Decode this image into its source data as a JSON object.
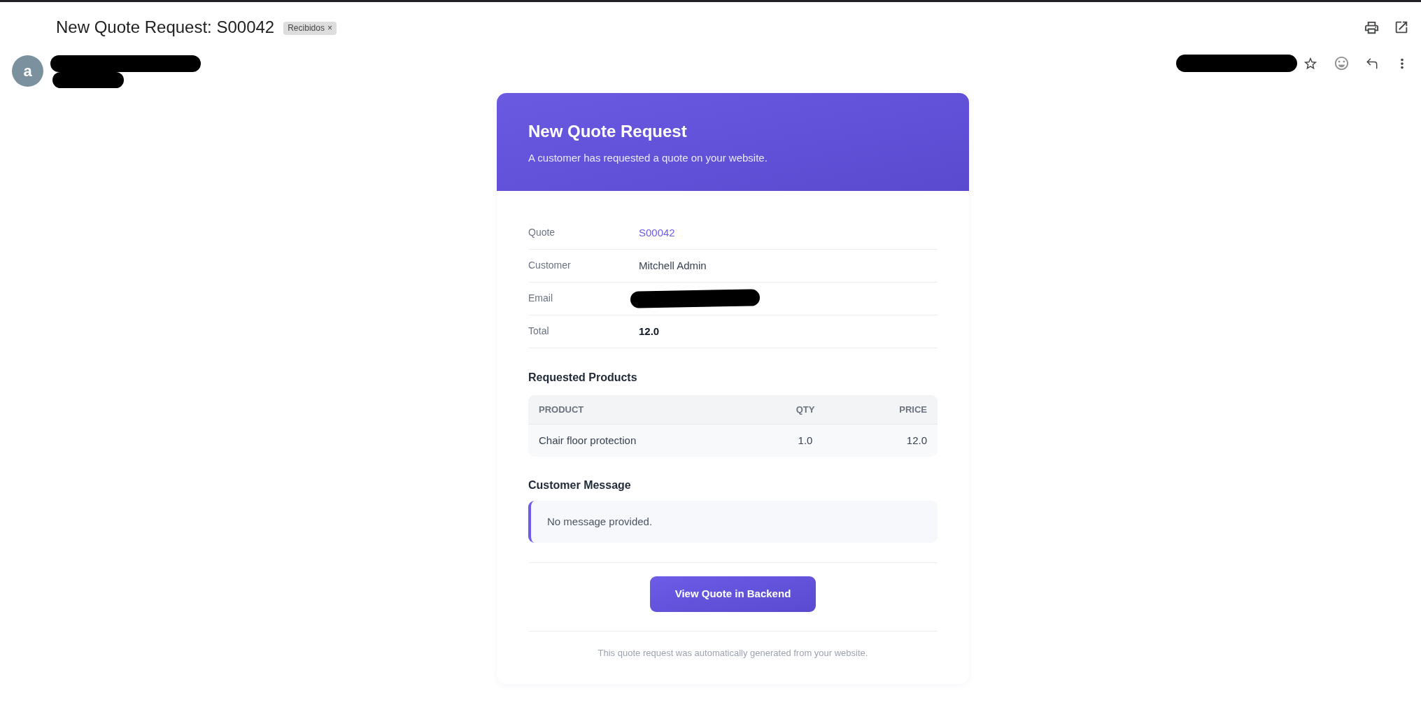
{
  "subject": {
    "title": "New Quote Request: S00042",
    "label_chip": {
      "text": "Recibidos",
      "remove": "×"
    }
  },
  "sender": {
    "avatar_letter": "a",
    "name_redacted": true,
    "address_redacted": true,
    "date_redacted": true
  },
  "email": {
    "header": {
      "title": "New Quote Request",
      "subtitle": "A customer has requested a quote on your website."
    },
    "details": [
      {
        "label": "Quote",
        "kind": "link",
        "value": "S00042"
      },
      {
        "label": "Customer",
        "kind": "text",
        "value": "Mitchell Admin"
      },
      {
        "label": "Email",
        "kind": "redacted"
      },
      {
        "label": "Total",
        "kind": "strong",
        "value": "12.0"
      }
    ],
    "products": {
      "title": "Requested Products",
      "columns": [
        "PRODUCT",
        "QTY",
        "PRICE"
      ],
      "rows": [
        [
          "Chair floor protection",
          "1.0",
          "12.0"
        ]
      ]
    },
    "message": {
      "title": "Customer Message",
      "text": "No message provided."
    },
    "action_button": "View Quote in Backend",
    "footer": "This quote request was automatically generated from your website."
  }
}
